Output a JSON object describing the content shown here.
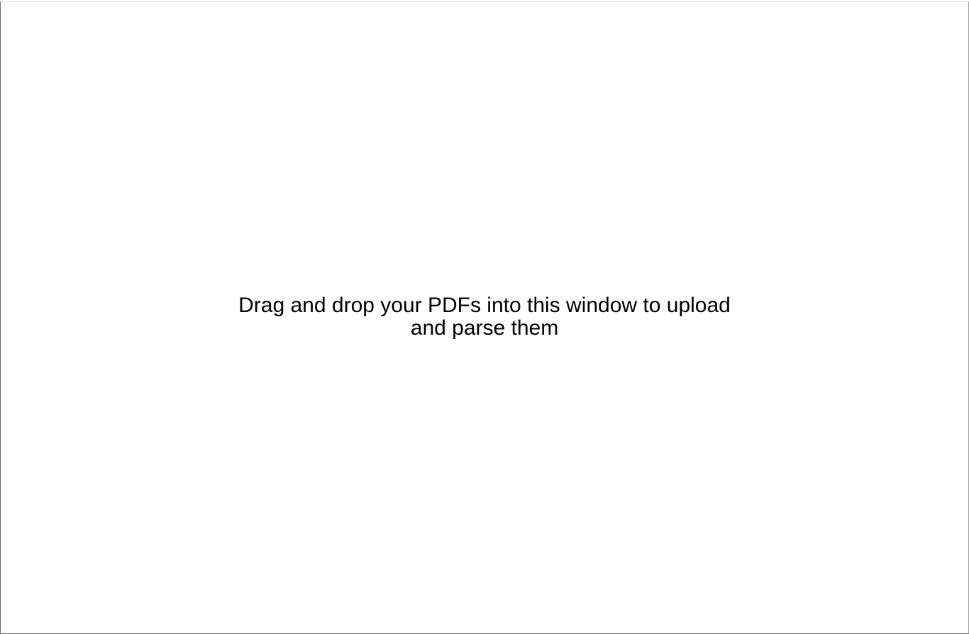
{
  "drop_zone": {
    "message_line_1": "Drag and drop your PDFs into this window to upload",
    "message_line_2": "and parse them"
  }
}
